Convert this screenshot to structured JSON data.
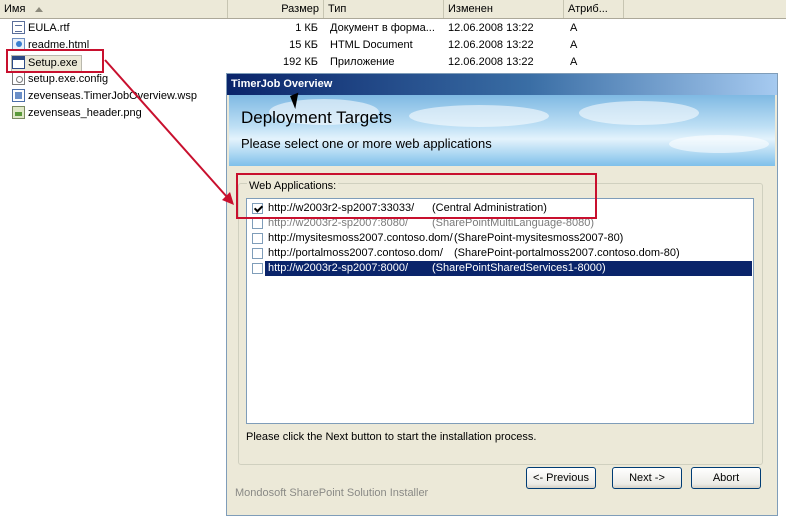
{
  "explorer": {
    "columns": {
      "name": "Имя",
      "size": "Размер",
      "type": "Тип",
      "modified": "Изменен",
      "attributes": "Атриб..."
    },
    "files": [
      {
        "name": "EULA.rtf",
        "icon": "rtf-file-icon",
        "size": "1 КБ",
        "type": "Документ в форма...",
        "modified": "12.06.2008 13:22",
        "attr": "A"
      },
      {
        "name": "readme.html",
        "icon": "html-file-icon",
        "size": "15 КБ",
        "type": "HTML Document",
        "modified": "12.06.2008 13:22",
        "attr": "A"
      },
      {
        "name": "Setup.exe",
        "icon": "exe-file-icon",
        "size": "192 КБ",
        "type": "Приложение",
        "modified": "12.06.2008 13:22",
        "attr": "A"
      },
      {
        "name": "setup.exe.config",
        "icon": "config-file-icon"
      },
      {
        "name": "zevenseas.TimerJobOverview.wsp",
        "icon": "wsp-file-icon"
      },
      {
        "name": "zevenseas_header.png",
        "icon": "png-file-icon"
      }
    ]
  },
  "installer": {
    "title": "TimerJob Overview",
    "banner_title": "Deployment Targets",
    "banner_subtitle": "Please select one or more web applications",
    "group_label": "Web Applications:",
    "web_applications": [
      {
        "url": "http://w2003r2-sp2007:33033/",
        "name": "(Central Administration)",
        "checked": true,
        "state": "normal"
      },
      {
        "url": "http://w2003r2-sp2007:8080/",
        "name": "(SharePointMultiLanguage-8080)",
        "checked": false,
        "state": "faint"
      },
      {
        "url": "http://mysitesmoss2007.contoso.dom/",
        "name": "(SharePoint-mysitesmoss2007-80)",
        "checked": false,
        "state": "normal"
      },
      {
        "url": "http://portalmoss2007.contoso.dom/",
        "name": "(SharePoint-portalmoss2007.contoso.dom-80)",
        "checked": false,
        "state": "normal"
      },
      {
        "url": "http://w2003r2-sp2007:8000/",
        "name": "(SharePointSharedServices1-8000)",
        "checked": false,
        "state": "selected"
      }
    ],
    "hint": "Please click the Next button to start the installation process.",
    "footer_brand": "Mondosoft SharePoint Solution Installer",
    "buttons": {
      "previous": "<- Previous",
      "next": "Next ->",
      "abort": "Abort"
    }
  },
  "colors": {
    "highlight_red": "#c8102e",
    "selection_blue": "#0a246a",
    "dialog_face": "#ece9d8"
  }
}
